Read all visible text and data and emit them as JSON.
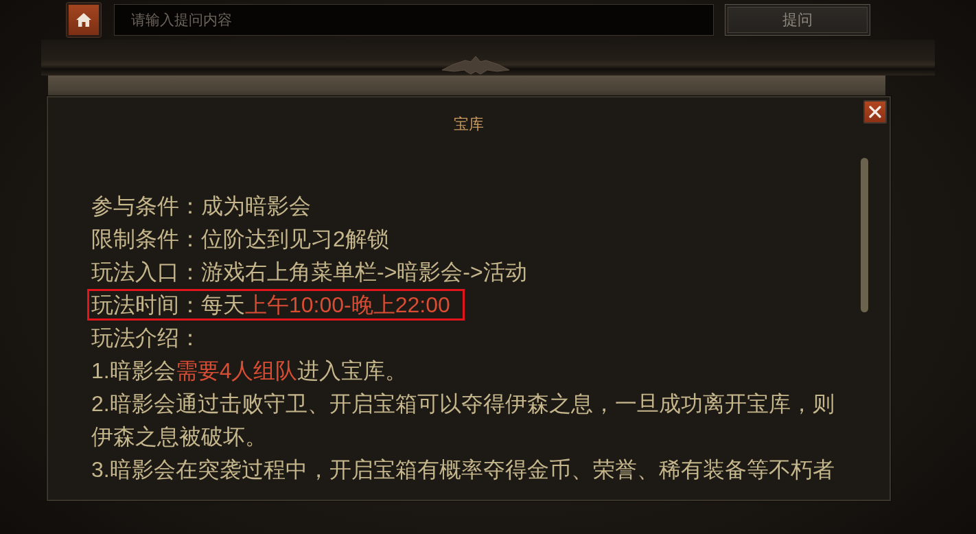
{
  "top_bar": {
    "search": {
      "placeholder": "请输入提问内容"
    },
    "ask_button": "提问"
  },
  "dialog": {
    "title": "宝库",
    "lines": [
      {
        "marked": false,
        "segments": [
          {
            "text": "参与条件：成为暗影会",
            "emphasis": false
          }
        ]
      },
      {
        "marked": false,
        "segments": [
          {
            "text": "限制条件：位阶达到见习2解锁",
            "emphasis": false
          }
        ]
      },
      {
        "marked": false,
        "segments": [
          {
            "text": "玩法入口：游戏右上角菜单栏->暗影会->活动",
            "emphasis": false
          }
        ]
      },
      {
        "marked": true,
        "segments": [
          {
            "text": "玩法时间：每天",
            "emphasis": false
          },
          {
            "text": "上午10:00-晚上22:00",
            "emphasis": true
          }
        ]
      },
      {
        "marked": false,
        "segments": [
          {
            "text": "玩法介绍：",
            "emphasis": false
          }
        ]
      },
      {
        "marked": false,
        "segments": [
          {
            "text": "1.暗影会",
            "emphasis": false
          },
          {
            "text": "需要4人组队",
            "emphasis": true
          },
          {
            "text": "进入宝库。",
            "emphasis": false
          }
        ]
      },
      {
        "marked": false,
        "segments": [
          {
            "text": "2.暗影会通过击败守卫、开启宝箱可以夺得伊森之息，一旦成功离开宝库，则伊森之息被破坏。",
            "emphasis": false
          }
        ]
      },
      {
        "marked": false,
        "segments": [
          {
            "text": "3.暗影会在突袭过程中，开启宝箱有概率夺得金币、荣誉、稀有装备等不朽者",
            "emphasis": false
          }
        ]
      }
    ]
  }
}
